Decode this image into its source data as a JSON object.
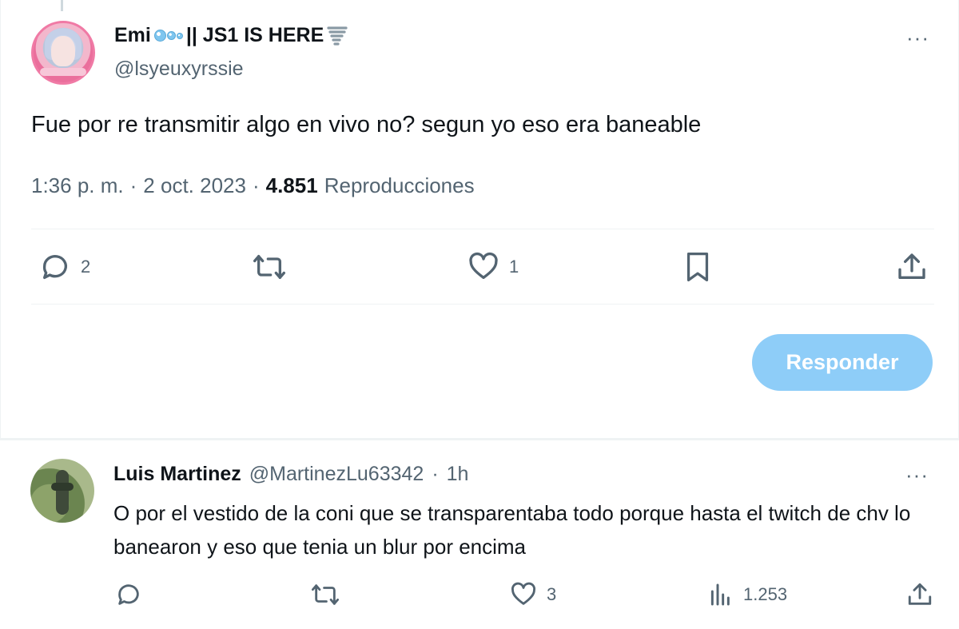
{
  "main_tweet": {
    "display_name": "Emi",
    "display_name_suffix": "|| JS1 IS HERE",
    "handle": "@lsyeuxyrssie",
    "more_label": "···",
    "text": "Fue por re transmitir algo en vivo no? segun yo eso era baneable",
    "time": "1:36 p. m.",
    "sep1": "·",
    "date": "2 oct. 2023",
    "sep2": "·",
    "views_count": "4.851",
    "views_label": "Reproducciones",
    "actions": {
      "reply_count": "2",
      "retweet_count": "",
      "like_count": "1"
    },
    "icons": [
      "bubble-icon",
      "tornado-icon",
      "reply-icon",
      "retweet-icon",
      "like-icon",
      "bookmark-icon",
      "share-icon"
    ]
  },
  "reply_box": {
    "button_label": "Responder"
  },
  "reply_tweet": {
    "display_name": "Luis Martinez",
    "handle": "@MartinezLu63342",
    "sep": "·",
    "time": "1h",
    "more_label": "···",
    "text": "O por el vestido de la coni que se transparentaba todo porque hasta el twitch de chv lo banearon y eso que tenia un blur por encima",
    "actions": {
      "reply_count": "",
      "retweet_count": "",
      "like_count": "3",
      "views_count": "1.253"
    },
    "icons": [
      "reply-icon",
      "retweet-icon",
      "like-icon",
      "analytics-icon",
      "share-icon"
    ]
  },
  "colors": {
    "text_primary": "#0f1419",
    "text_secondary": "#536471",
    "divider": "#eff3f4",
    "reply_button_bg": "#8ecdf8",
    "reply_button_text": "#ffffff"
  }
}
